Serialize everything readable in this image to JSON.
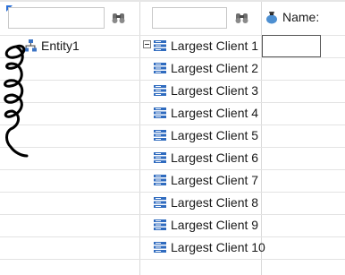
{
  "header": {
    "filter1_value": "",
    "filter2_value": "",
    "name_label": "Name:"
  },
  "tree": {
    "root_label": "Entity1",
    "children": [
      "Largest Client 1",
      "Largest Client 2",
      "Largest Client 3",
      "Largest Client 4",
      "Largest Client 5",
      "Largest Client 6",
      "Largest Client 7",
      "Largest Client 8",
      "Largest Client 9",
      "Largest Client 10"
    ]
  },
  "name_cell_value": "",
  "icons": {
    "filter": "binoculars-icon",
    "name": "bag-icon",
    "root": "network-icon",
    "child": "server-icon"
  },
  "colors": {
    "accent": "#2b6fd6",
    "grid": "#d9d9d9",
    "text": "#1a1a1a"
  }
}
